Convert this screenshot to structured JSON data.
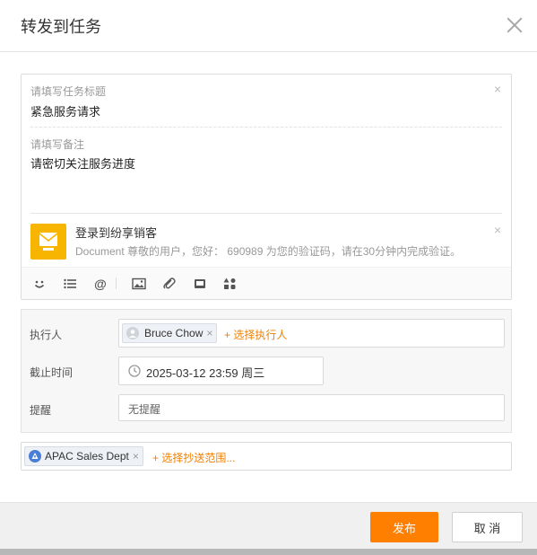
{
  "dialog": {
    "title": "转发到任务"
  },
  "editor": {
    "title_label": "请填写任务标题",
    "title_value": "紧急服务请求",
    "note_label": "请填写备注",
    "note_value": "请密切关注服务进度",
    "card": {
      "title": "登录到纷享销客",
      "desc": "Document 尊敬的用户，您好： 690989 为您的验证码，请在30分钟内完成验证。"
    },
    "toolbar": [
      "emoji-icon",
      "list-icon",
      "at-icon",
      "image-icon",
      "attachment-icon",
      "card-icon",
      "apps-icon"
    ]
  },
  "form": {
    "assignee_label": "执行人",
    "assignee_chip": "Bruce Chow",
    "assignee_add": "+ 选择执行人",
    "deadline_label": "截止时间",
    "deadline_value": "2025-03-12 23:59 周三",
    "remind_label": "提醒",
    "remind_value": "无提醒"
  },
  "cc": {
    "chip": "APAC Sales Dept",
    "add": "+ 选择抄送范围..."
  },
  "footer": {
    "publish": "发布",
    "cancel": "取 消"
  },
  "colors": {
    "accent": "#ff7f00",
    "link": "#f08000",
    "card_icon": "#f7b500",
    "dept_icon": "#4a7ed6"
  }
}
